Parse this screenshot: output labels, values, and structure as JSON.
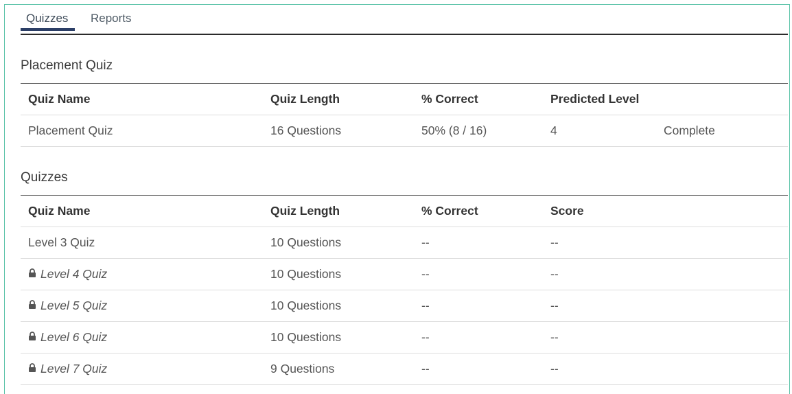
{
  "tabs": [
    {
      "label": "Quizzes",
      "active": true
    },
    {
      "label": "Reports",
      "active": false
    }
  ],
  "placement": {
    "title": "Placement Quiz",
    "headers": [
      "Quiz Name",
      "Quiz Length",
      "% Correct",
      "Predicted Level"
    ],
    "row": {
      "name": "Placement Quiz",
      "length": "16 Questions",
      "correct": "50% (8 / 16)",
      "level": "4",
      "status": "Complete"
    }
  },
  "quizzes": {
    "title": "Quizzes",
    "headers": [
      "Quiz Name",
      "Quiz Length",
      "% Correct",
      "Score"
    ],
    "rows": [
      {
        "name": "Level 3 Quiz",
        "length": "10 Questions",
        "correct": "--",
        "score": "--",
        "locked": false
      },
      {
        "name": "Level 4 Quiz",
        "length": "10 Questions",
        "correct": "--",
        "score": "--",
        "locked": true
      },
      {
        "name": "Level 5 Quiz",
        "length": "10 Questions",
        "correct": "--",
        "score": "--",
        "locked": true
      },
      {
        "name": "Level 6 Quiz",
        "length": "10 Questions",
        "correct": "--",
        "score": "--",
        "locked": true
      },
      {
        "name": "Level 7 Quiz",
        "length": "9 Questions",
        "correct": "--",
        "score": "--",
        "locked": true
      }
    ]
  },
  "icons": {
    "lock": "lock-icon"
  },
  "colors": {
    "accent_border": "#5bc3a8",
    "tab_underline": "#2b3e66",
    "complete_status": "#2c8a62"
  }
}
